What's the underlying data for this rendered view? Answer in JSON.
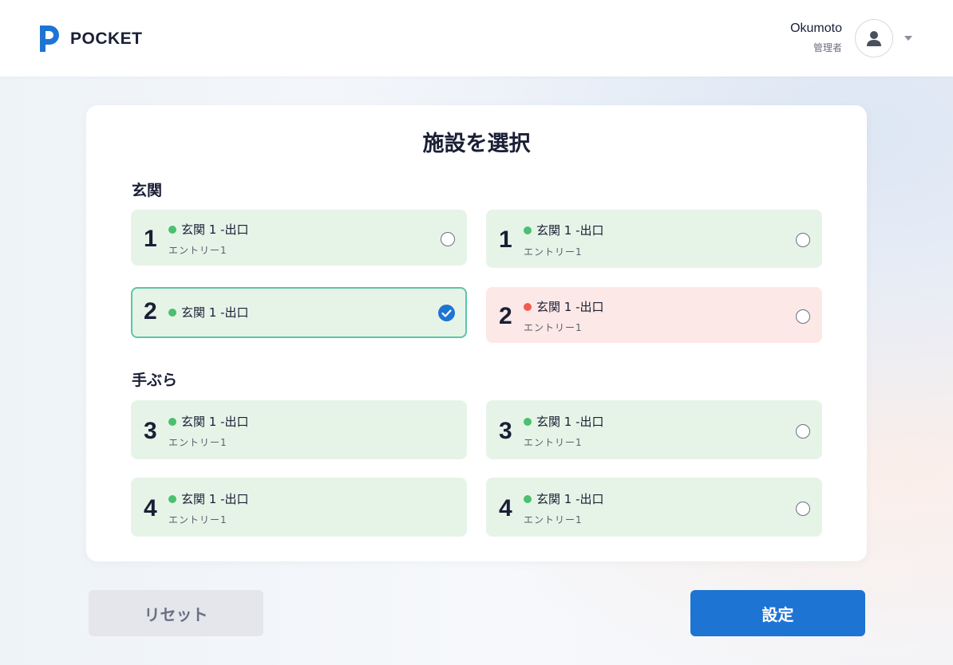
{
  "app": {
    "logo_text": "POCKET"
  },
  "user": {
    "name": "Okumoto",
    "role": "管理者"
  },
  "dialog": {
    "title": "施設を選択"
  },
  "groups": [
    {
      "label": "玄関",
      "options": [
        {
          "number": "1",
          "title": "玄関 1 -出口",
          "subtitle": "エントリー1",
          "status": "green",
          "selected": false
        },
        {
          "number": "1",
          "title": "玄関 1 -出口",
          "subtitle": "エントリー1",
          "status": "green",
          "selected": false
        },
        {
          "number": "2",
          "title": "玄関 1 -出口",
          "subtitle": "",
          "status": "green",
          "selected": true
        },
        {
          "number": "2",
          "title": "玄関 1 -出口",
          "subtitle": "エントリー1",
          "status": "red",
          "selected": false
        }
      ]
    },
    {
      "label": "手ぶら",
      "options": [
        {
          "number": "3",
          "title": "玄関 1 -出口",
          "subtitle": "エントリー1",
          "status": "green",
          "selected": false
        },
        {
          "number": "3",
          "title": "玄関 1 -出口",
          "subtitle": "エントリー1",
          "status": "green",
          "selected": false
        },
        {
          "number": "4",
          "title": "玄関 1 -出口",
          "subtitle": "エントリー1",
          "status": "green",
          "selected": false
        },
        {
          "number": "4",
          "title": "玄関 1 -出口",
          "subtitle": "エントリー1",
          "status": "green",
          "selected": false
        }
      ]
    }
  ],
  "buttons": {
    "reset": "リセット",
    "submit": "設定"
  },
  "colors": {
    "primary": "#1e74d3",
    "status_ok": "#4cbf70",
    "status_error": "#f15c52",
    "option_bg": "#e6f4e8",
    "option_error_bg": "#fce8e6"
  }
}
